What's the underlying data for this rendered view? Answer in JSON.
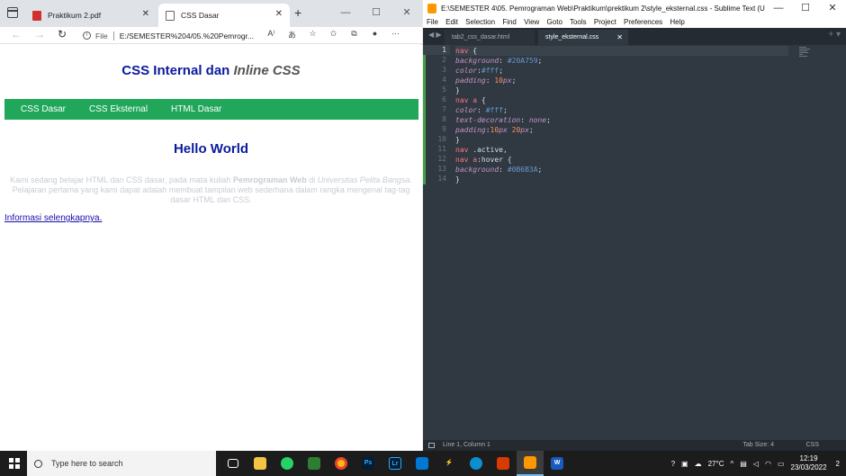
{
  "browser": {
    "tabs": [
      {
        "title": "Praktikum 2.pdf"
      },
      {
        "title": "CSS Dasar"
      }
    ],
    "address": {
      "info_label": "File",
      "url": "E:/SEMESTER%204/05.%20Pemrogr..."
    }
  },
  "page": {
    "h1_plain": "CSS Internal dan ",
    "h1_italic": "Inline CSS",
    "nav": [
      "CSS Dasar",
      "CSS Eksternal",
      "HTML Dasar"
    ],
    "h2": "Hello World",
    "p": {
      "part1": "Kami sedang belajar HTML dan CSS dasar, pada mata kuliah ",
      "bold": "Pemrograman Web",
      "part2": " di ",
      "italic": "Universitas Pelita Bangsa",
      "part3": ". Pelajaran pertama yang kami dapat adalah membuat tampilan web sederhana dalam rangka mengenal tag-tag dasar HTML dan CSS."
    },
    "link": "Informasi selengkapnya."
  },
  "sublime": {
    "title": "E:\\SEMESTER 4\\05. Pemrograman Web\\Praktikum\\prektikum 2\\style_eksternal.css - Sublime Text (UNREGISTERE...",
    "menu": [
      "File",
      "Edit",
      "Selection",
      "Find",
      "View",
      "Goto",
      "Tools",
      "Project",
      "Preferences",
      "Help"
    ],
    "tabs": [
      {
        "title": "tab2_css_dasar.html"
      },
      {
        "title": "style_eksternal.css"
      }
    ],
    "line_numbers": [
      "1",
      "2",
      "3",
      "4",
      "5",
      "6",
      "7",
      "8",
      "9",
      "10",
      "11",
      "12",
      "13",
      "14"
    ],
    "status": {
      "position": "Line 1, Column 1",
      "tab_size": "Tab Size: 4",
      "syntax": "CSS"
    }
  },
  "taskbar": {
    "search_placeholder": "Type here to search",
    "weather": "27°C",
    "time": "12:19",
    "date": "23/03/2022",
    "notifications": "2"
  }
}
